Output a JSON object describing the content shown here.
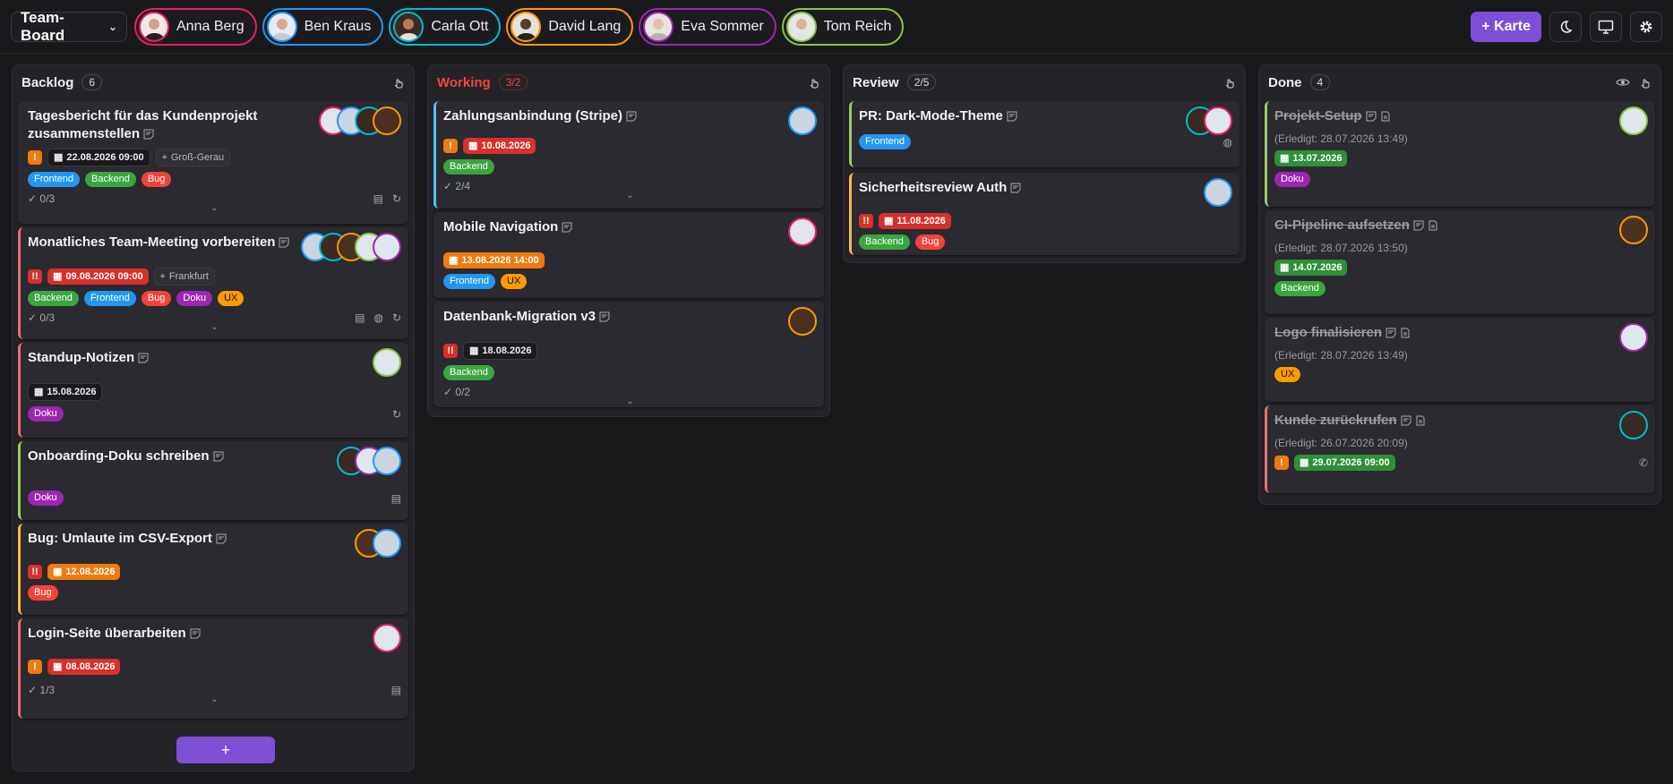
{
  "toolbar": {
    "board": "Team-Board",
    "add_card": "+ Karte"
  },
  "people": [
    {
      "name": "Anna Berg",
      "color": "#e91e63"
    },
    {
      "name": "Ben Kraus",
      "color": "#2196f3"
    },
    {
      "name": "Carla Ott",
      "color": "#00bcd4"
    },
    {
      "name": "David Lang",
      "color": "#ff9800"
    },
    {
      "name": "Eva Sommer",
      "color": "#9c27b0"
    },
    {
      "name": "Tom Reich",
      "color": "#8bc34a"
    }
  ],
  "columns": {
    "backlog": {
      "title": "Backlog",
      "count": "6",
      "add": "+"
    },
    "working": {
      "title": "Working",
      "count": "3/2"
    },
    "review": {
      "title": "Review",
      "count": "2/5"
    },
    "done": {
      "title": "Done",
      "count": "4"
    }
  },
  "backlog": [
    {
      "title": "Tagesbericht für das Kundenprojekt zusammenstellen",
      "prio": "!",
      "date": "22.08.2026 09:00",
      "location": "Groß-Gerau",
      "tags": [
        "Frontend",
        "Backend",
        "Bug"
      ],
      "checklist": "0/3"
    },
    {
      "title": "Monatliches Team-Meeting vorbereiten",
      "prio": "!!",
      "date": "09.08.2026 09:00",
      "location": "Frankfurt",
      "tags": [
        "Backend",
        "Frontend",
        "Bug",
        "Doku",
        "UX"
      ],
      "checklist": "0/3"
    },
    {
      "title": "Standup-Notizen",
      "date": "15.08.2026",
      "tags": [
        "Doku"
      ]
    },
    {
      "title": "Onboarding-Doku schreiben",
      "tags": [
        "Doku"
      ]
    },
    {
      "title": "Bug: Umlaute im CSV-Export",
      "prio": "!!",
      "date": "12.08.2026",
      "tags": [
        "Bug"
      ]
    },
    {
      "title": "Login-Seite überarbeiten",
      "prio": "!",
      "date": "08.08.2026",
      "checklist": "1/3"
    }
  ],
  "working": [
    {
      "title": "Zahlungsanbindung (Stripe)",
      "prio": "!",
      "date": "10.08.2026",
      "tags": [
        "Backend"
      ],
      "checklist": "2/4"
    },
    {
      "title": "Mobile Navigation",
      "date": "13.08.2026 14:00",
      "tags": [
        "Frontend",
        "UX"
      ]
    },
    {
      "title": "Datenbank-Migration v3",
      "prio": "!!",
      "date": "18.08.2026",
      "tags": [
        "Backend"
      ],
      "checklist": "0/2"
    }
  ],
  "review": [
    {
      "title": "PR: Dark-Mode-Theme",
      "tags": [
        "Frontend"
      ]
    },
    {
      "title": "Sicherheitsreview Auth",
      "prio": "!!",
      "date": "11.08.2026",
      "tags": [
        "Backend",
        "Bug"
      ]
    }
  ],
  "done": [
    {
      "title": "Projekt-Setup",
      "done": "(Erledigt: 28.07.2026 13:49)",
      "date": "13.07.2026",
      "tags": [
        "Doku"
      ]
    },
    {
      "title": "CI-Pipeline aufsetzen",
      "done": "(Erledigt: 28.07.2026 13:50)",
      "date": "14.07.2026",
      "tags": [
        "Backend"
      ]
    },
    {
      "title": "Logo finalisieren",
      "done": "(Erledigt: 28.07.2026 13:49)",
      "tags": [
        "UX"
      ]
    },
    {
      "title": "Kunde zurückrufen",
      "done": "(Erledigt: 26.07.2026 20:09)",
      "prio": "!",
      "date": "29.07.2026 09:00"
    }
  ]
}
